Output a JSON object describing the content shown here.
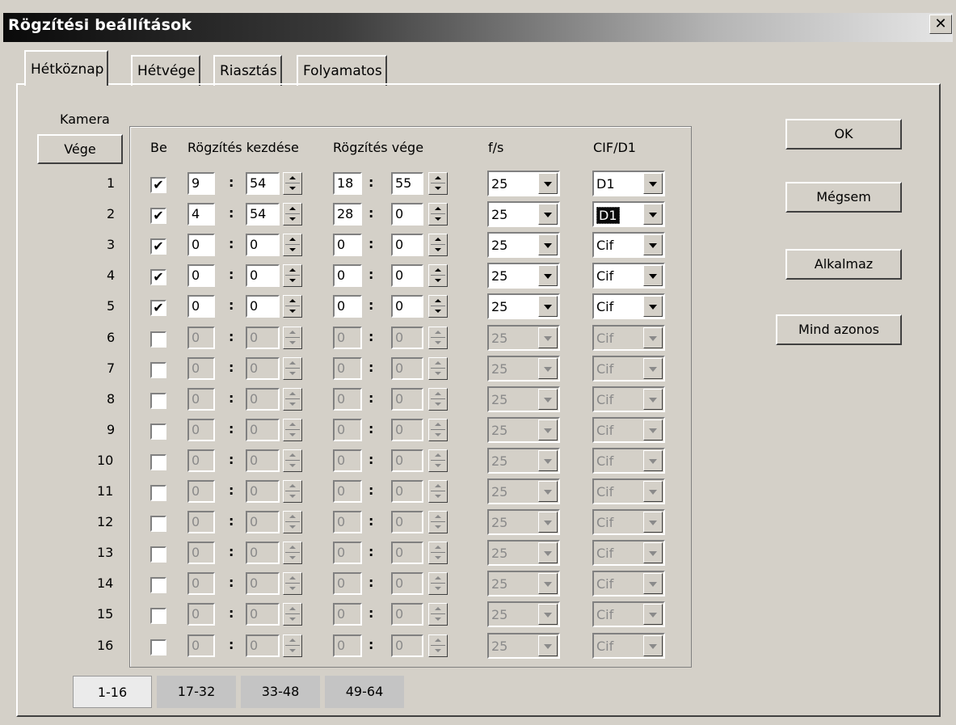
{
  "window": {
    "title": "Rögzítési beállítások",
    "close_label": "✕"
  },
  "tabs": [
    {
      "label": "Hétköznap",
      "active": true
    },
    {
      "label": "Hétvége",
      "active": false
    },
    {
      "label": "Riasztás",
      "active": false
    },
    {
      "label": "Folyamatos",
      "active": false
    }
  ],
  "camera_label": "Kamera",
  "vege_button": "Vége",
  "columns": {
    "be": "Be",
    "start": "Rögzítés kezdése",
    "end": "Rögzítés vége",
    "fps": "f/s",
    "res": "CIF/D1"
  },
  "separator": ":",
  "rows": [
    {
      "cam": "1",
      "checked": true,
      "sh": "9",
      "sm": "54",
      "eh": "18",
      "em": "55",
      "fps": "25",
      "res": "D1",
      "enabled": true
    },
    {
      "cam": "2",
      "checked": true,
      "sh": "4",
      "sm": "54",
      "eh": "28",
      "em": "0",
      "fps": "25",
      "res": "D1",
      "enabled": true,
      "res_selected": true
    },
    {
      "cam": "3",
      "checked": true,
      "sh": "0",
      "sm": "0",
      "eh": "0",
      "em": "0",
      "fps": "25",
      "res": "Cif",
      "enabled": true
    },
    {
      "cam": "4",
      "checked": true,
      "sh": "0",
      "sm": "0",
      "eh": "0",
      "em": "0",
      "fps": "25",
      "res": "Cif",
      "enabled": true
    },
    {
      "cam": "5",
      "checked": true,
      "sh": "0",
      "sm": "0",
      "eh": "0",
      "em": "0",
      "fps": "25",
      "res": "Cif",
      "enabled": true
    },
    {
      "cam": "6",
      "checked": false,
      "sh": "0",
      "sm": "0",
      "eh": "0",
      "em": "0",
      "fps": "25",
      "res": "Cif",
      "enabled": false
    },
    {
      "cam": "7",
      "checked": false,
      "sh": "0",
      "sm": "0",
      "eh": "0",
      "em": "0",
      "fps": "25",
      "res": "Cif",
      "enabled": false
    },
    {
      "cam": "8",
      "checked": false,
      "sh": "0",
      "sm": "0",
      "eh": "0",
      "em": "0",
      "fps": "25",
      "res": "Cif",
      "enabled": false
    },
    {
      "cam": "9",
      "checked": false,
      "sh": "0",
      "sm": "0",
      "eh": "0",
      "em": "0",
      "fps": "25",
      "res": "Cif",
      "enabled": false
    },
    {
      "cam": "10",
      "checked": false,
      "sh": "0",
      "sm": "0",
      "eh": "0",
      "em": "0",
      "fps": "25",
      "res": "Cif",
      "enabled": false
    },
    {
      "cam": "11",
      "checked": false,
      "sh": "0",
      "sm": "0",
      "eh": "0",
      "em": "0",
      "fps": "25",
      "res": "Cif",
      "enabled": false
    },
    {
      "cam": "12",
      "checked": false,
      "sh": "0",
      "sm": "0",
      "eh": "0",
      "em": "0",
      "fps": "25",
      "res": "Cif",
      "enabled": false
    },
    {
      "cam": "13",
      "checked": false,
      "sh": "0",
      "sm": "0",
      "eh": "0",
      "em": "0",
      "fps": "25",
      "res": "Cif",
      "enabled": false
    },
    {
      "cam": "14",
      "checked": false,
      "sh": "0",
      "sm": "0",
      "eh": "0",
      "em": "0",
      "fps": "25",
      "res": "Cif",
      "enabled": false
    },
    {
      "cam": "15",
      "checked": false,
      "sh": "0",
      "sm": "0",
      "eh": "0",
      "em": "0",
      "fps": "25",
      "res": "Cif",
      "enabled": false
    },
    {
      "cam": "16",
      "checked": false,
      "sh": "0",
      "sm": "0",
      "eh": "0",
      "em": "0",
      "fps": "25",
      "res": "Cif",
      "enabled": false
    }
  ],
  "buttons": {
    "ok": "OK",
    "cancel": "Mégsem",
    "apply": "Alkalmaz",
    "all_same": "Mind azonos"
  },
  "page_tabs": [
    {
      "label": "1-16",
      "active": true
    },
    {
      "label": "17-32",
      "active": false
    },
    {
      "label": "33-48",
      "active": false
    },
    {
      "label": "49-64",
      "active": false
    }
  ],
  "icons": {
    "check": "✔",
    "close": "close-icon",
    "spin": "spinner-arrows-icon",
    "dropdown": "chevron-down-icon"
  }
}
